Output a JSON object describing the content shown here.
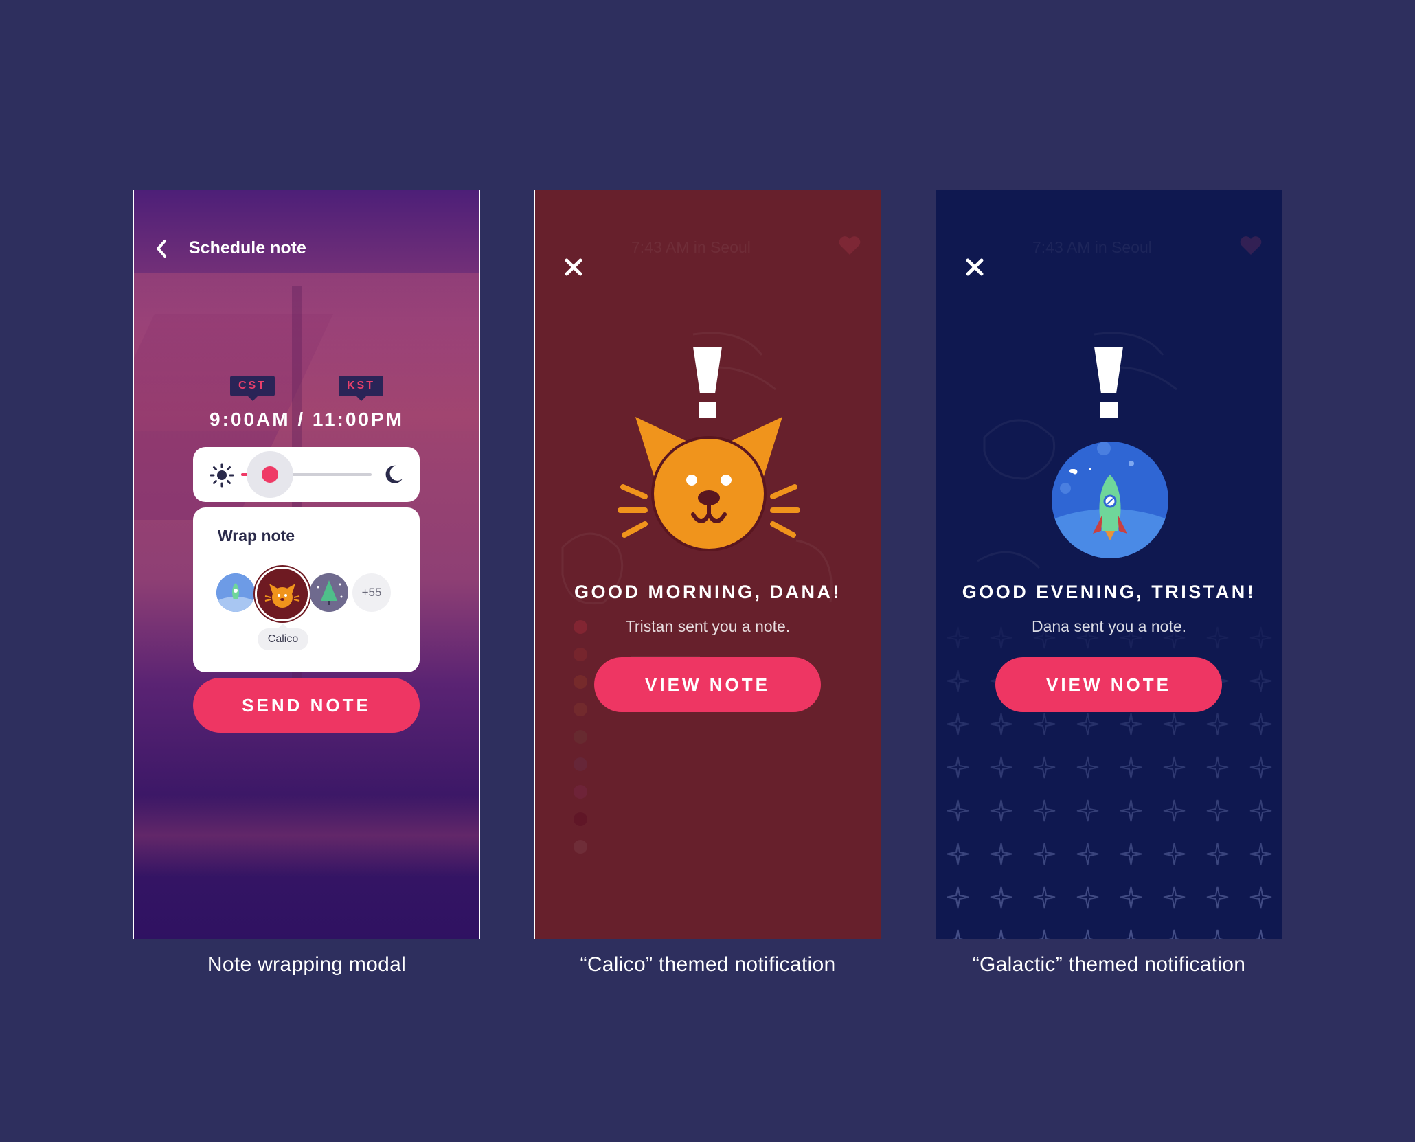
{
  "screens": [
    {
      "header": {
        "title": "Schedule note"
      },
      "timezones": {
        "left": "CST",
        "right": "KST"
      },
      "time": "9:00AM / 11:00PM",
      "slider": {
        "value": 0.22
      },
      "wrap": {
        "title": "Wrap note",
        "options": [
          "galactic",
          "calico",
          "forest"
        ],
        "selected": "calico",
        "selected_label": "Calico",
        "more_count": "+55"
      },
      "button": "SEND NOTE",
      "caption": "Note wrapping modal"
    },
    {
      "status": "7:43 AM in Seoul",
      "greeting": "GOOD MORNING, DANA!",
      "subtext": "Tristan sent you a note.",
      "button": "VIEW NOTE",
      "caption": "“Calico” themed notification"
    },
    {
      "status": "7:43 AM in Seoul",
      "greeting": "GOOD EVENING, TRISTAN!",
      "subtext": "Dana sent you a note.",
      "button": "VIEW NOTE",
      "caption": "“Galactic” themed notification"
    }
  ],
  "colors": {
    "page_bg": "#2e2f5e",
    "accent": "#ee3663",
    "calico_bg": "#67202c",
    "galactic_bg": "#0f1850",
    "cat_orange": "#f0941c"
  }
}
